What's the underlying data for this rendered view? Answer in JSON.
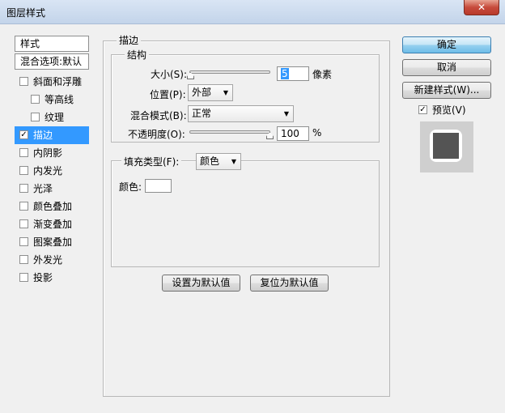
{
  "window": {
    "title": "图层样式",
    "close_label": "✕"
  },
  "style_list": {
    "header": "样式",
    "blend_options": "混合选项:默认",
    "items": [
      {
        "label": "斜面和浮雕",
        "checked": false
      },
      {
        "label": "等高线",
        "checked": false
      },
      {
        "label": "纹理",
        "checked": false
      },
      {
        "label": "描边",
        "checked": true
      },
      {
        "label": "内阴影",
        "checked": false
      },
      {
        "label": "内发光",
        "checked": false
      },
      {
        "label": "光泽",
        "checked": false
      },
      {
        "label": "颜色叠加",
        "checked": false
      },
      {
        "label": "渐变叠加",
        "checked": false
      },
      {
        "label": "图案叠加",
        "checked": false
      },
      {
        "label": "外发光",
        "checked": false
      },
      {
        "label": "投影",
        "checked": false
      }
    ],
    "selected": "描边"
  },
  "stroke": {
    "section_title": "描边",
    "structure_title": "结构",
    "size": {
      "label": "大小(S):",
      "value": "5",
      "unit": "像素",
      "slider_fraction": 0.02
    },
    "position": {
      "label": "位置(P):",
      "value": "外部"
    },
    "blend_mode": {
      "label": "混合模式(B):",
      "value": "正常"
    },
    "opacity": {
      "label": "不透明度(O):",
      "value": "100",
      "unit": "%",
      "slider_fraction": 1.0
    },
    "fill_type": {
      "label": "填充类型(F):",
      "value": "颜色"
    },
    "color": {
      "label": "颜色:",
      "value": "#ffffff"
    },
    "make_default_label": "设置为默认值",
    "reset_default_label": "复位为默认值"
  },
  "actions": {
    "ok_label": "确定",
    "cancel_label": "取消",
    "new_style_label": "新建样式(W)...",
    "preview_label": "预览(V)",
    "preview_checked": true
  },
  "colors": {
    "selection": "#3399ff",
    "preview_fill": "#545454",
    "preview_stroke": "#ffffff"
  }
}
